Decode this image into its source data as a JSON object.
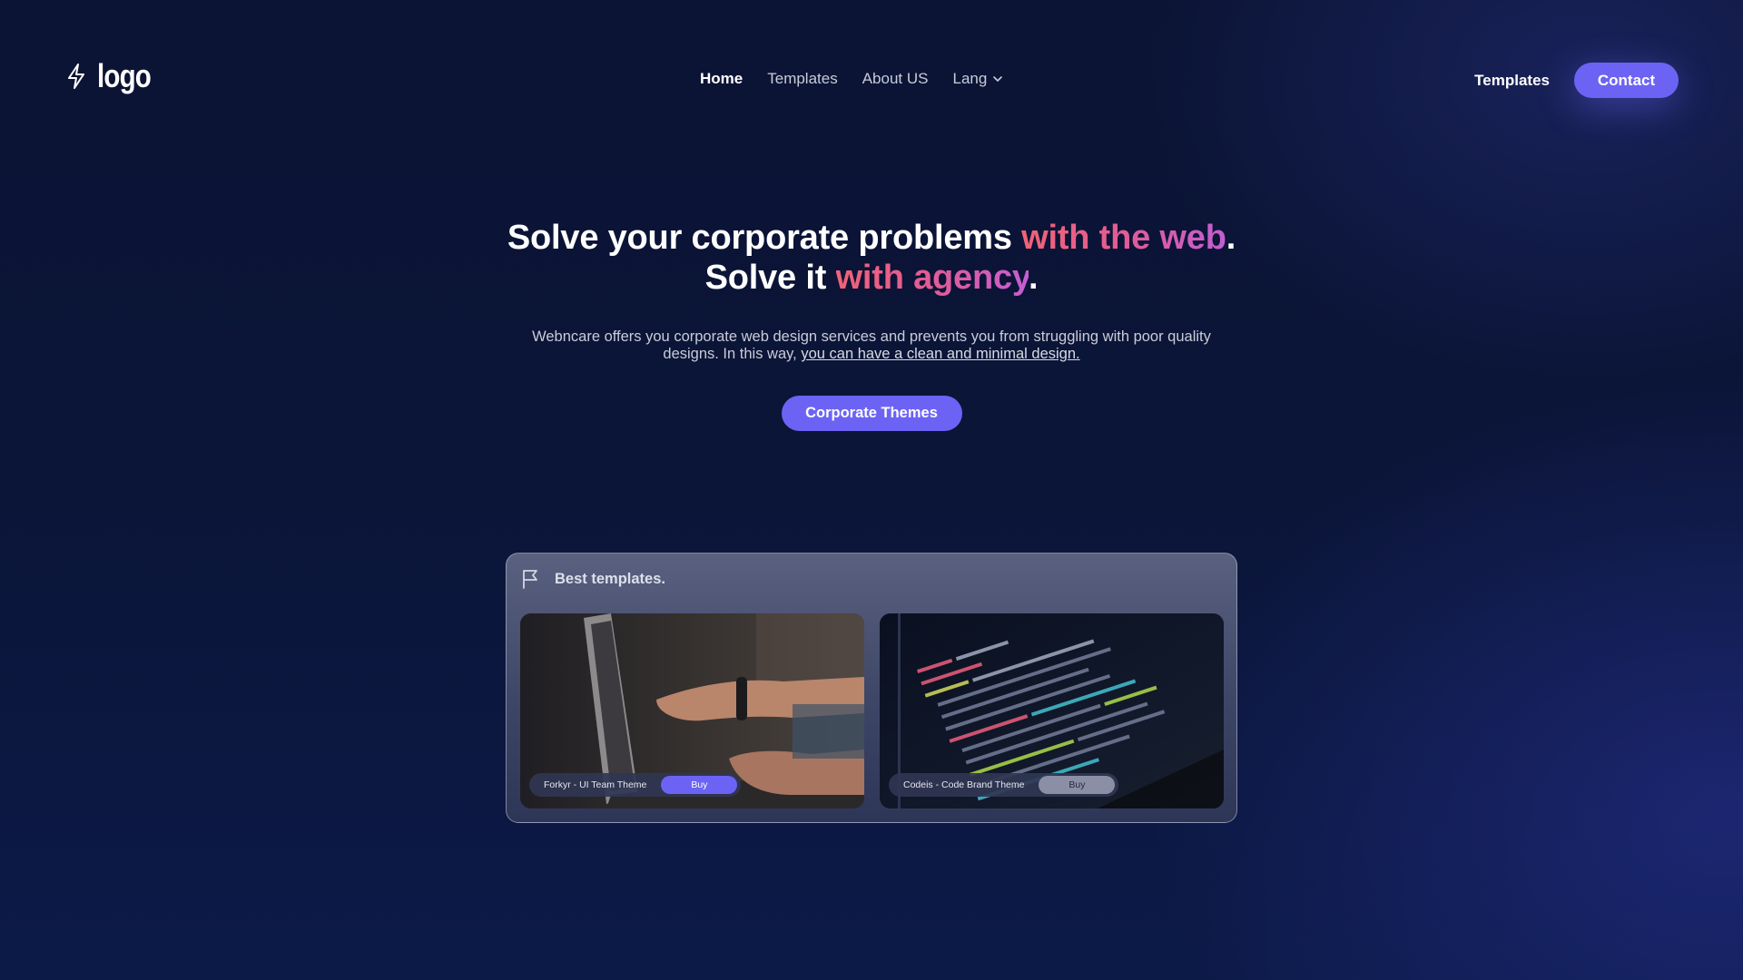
{
  "header": {
    "logo_text": "logo",
    "nav": {
      "home": "Home",
      "templates": "Templates",
      "about": "About US",
      "lang": "Lang"
    },
    "templates_link": "Templates",
    "contact_button": "Contact"
  },
  "hero": {
    "title_line1_a": "Solve your corporate problems ",
    "title_line1_highlight": "with the web",
    "title_line1_end": ".",
    "title_line2_a": "Solve it ",
    "title_line2_highlight": "with agency",
    "title_line2_end": ".",
    "description": "Webncare offers you corporate web design services and prevents you from struggling with poor quality designs. In this way, ",
    "description_link": "you can have a clean and minimal design.",
    "cta_button": "Corporate Themes"
  },
  "templates_panel": {
    "title": "Best templates.",
    "cards": [
      {
        "label": "Forkyr - UI Team Theme",
        "buy": "Buy"
      },
      {
        "label": "Codeis - Code Brand Theme",
        "buy": "Buy"
      }
    ]
  },
  "colors": {
    "accent": "#6c63f5",
    "highlight_start": "#f06277",
    "highlight_end": "#c35ed2",
    "background": "#0b1434"
  }
}
